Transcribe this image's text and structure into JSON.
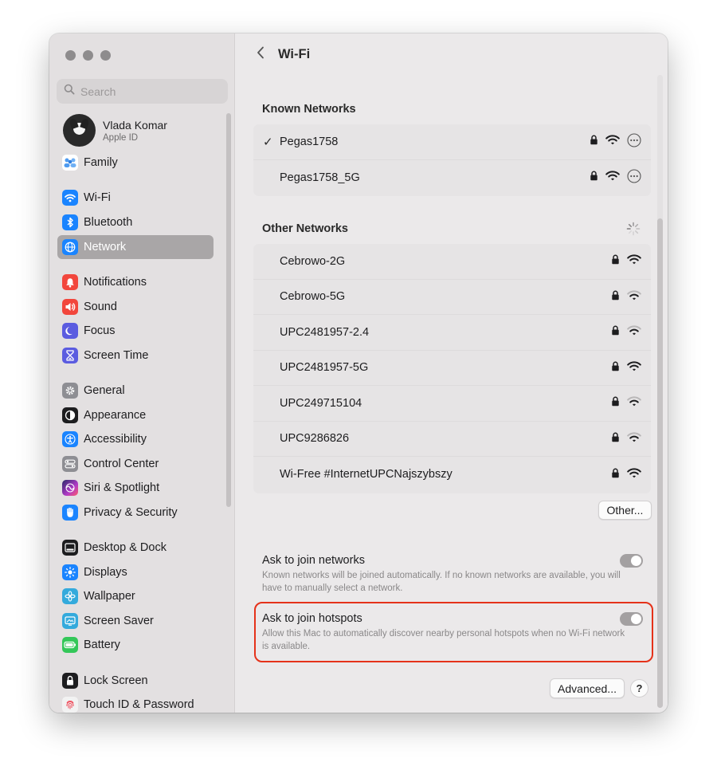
{
  "window": {
    "title": "Wi-Fi"
  },
  "search": {
    "placeholder": "Search"
  },
  "profile": {
    "name": "Vlada Komar",
    "subtitle": "Apple ID"
  },
  "sidebar": {
    "items": [
      {
        "label": "Family",
        "icon": "family-icon",
        "color": "#ffffff"
      },
      {
        "label": "Wi-Fi",
        "icon": "wifi-icon",
        "color": "#1a84ff"
      },
      {
        "label": "Bluetooth",
        "icon": "bluetooth-icon",
        "color": "#1a84ff"
      },
      {
        "label": "Network",
        "icon": "globe-icon",
        "color": "#1a84ff",
        "selected": true
      },
      {
        "label": "Notifications",
        "icon": "bell-icon",
        "color": "#f2463c"
      },
      {
        "label": "Sound",
        "icon": "speaker-icon",
        "color": "#f2463c"
      },
      {
        "label": "Focus",
        "icon": "moon-icon",
        "color": "#5b5ce0"
      },
      {
        "label": "Screen Time",
        "icon": "hourglass-icon",
        "color": "#5b5ce0"
      },
      {
        "label": "General",
        "icon": "gear-icon",
        "color": "#8e8e93"
      },
      {
        "label": "Appearance",
        "icon": "appearance-icon",
        "color": "#1d1d1f"
      },
      {
        "label": "Accessibility",
        "icon": "accessibility-icon",
        "color": "#1a84ff"
      },
      {
        "label": "Control Center",
        "icon": "control-center-icon",
        "color": "#8e8e93"
      },
      {
        "label": "Siri & Spotlight",
        "icon": "siri-icon",
        "color": "#b03ac7"
      },
      {
        "label": "Privacy & Security",
        "icon": "hand-icon",
        "color": "#1a84ff"
      },
      {
        "label": "Desktop & Dock",
        "icon": "dock-icon",
        "color": "#1d1d1f"
      },
      {
        "label": "Displays",
        "icon": "sun-icon",
        "color": "#1a84ff"
      },
      {
        "label": "Wallpaper",
        "icon": "flower-icon",
        "color": "#34aadc"
      },
      {
        "label": "Screen Saver",
        "icon": "screen-saver-icon",
        "color": "#34aadc"
      },
      {
        "label": "Battery",
        "icon": "battery-icon",
        "color": "#34c759"
      },
      {
        "label": "Lock Screen",
        "icon": "lock-icon",
        "color": "#1d1d1f"
      },
      {
        "label": "Touch ID & Password",
        "icon": "fingerprint-icon",
        "color": "#f2f2f2"
      }
    ]
  },
  "known": {
    "heading": "Known Networks",
    "networks": [
      {
        "name": "Pegas1758",
        "connected": true
      },
      {
        "name": "Pegas1758_5G",
        "connected": false
      }
    ]
  },
  "other": {
    "heading": "Other Networks",
    "networks": [
      {
        "name": "Cebrowo-2G",
        "signal": "strong"
      },
      {
        "name": "Cebrowo-5G",
        "signal": "weak"
      },
      {
        "name": "UPC2481957-2.4",
        "signal": "weak"
      },
      {
        "name": "UPC2481957-5G",
        "signal": "strong"
      },
      {
        "name": "UPC249715104",
        "signal": "weak"
      },
      {
        "name": "UPC9286826",
        "signal": "weak"
      },
      {
        "name": "Wi-Free #InternetUPCNajszybszy",
        "signal": "strong"
      }
    ],
    "other_button": "Other..."
  },
  "options": {
    "ask_join_networks": {
      "title": "Ask to join networks",
      "desc": "Known networks will be joined automatically. If no known networks are available, you will have to manually select a network."
    },
    "ask_join_hotspots": {
      "title": "Ask to join hotspots",
      "desc": "Allow this Mac to automatically discover nearby personal hotspots when no Wi-Fi network is available."
    }
  },
  "footer": {
    "advanced_button": "Advanced...",
    "help_label": "?"
  },
  "colors": {
    "highlight": "#e5321a",
    "accent_blue": "#1a84ff"
  }
}
